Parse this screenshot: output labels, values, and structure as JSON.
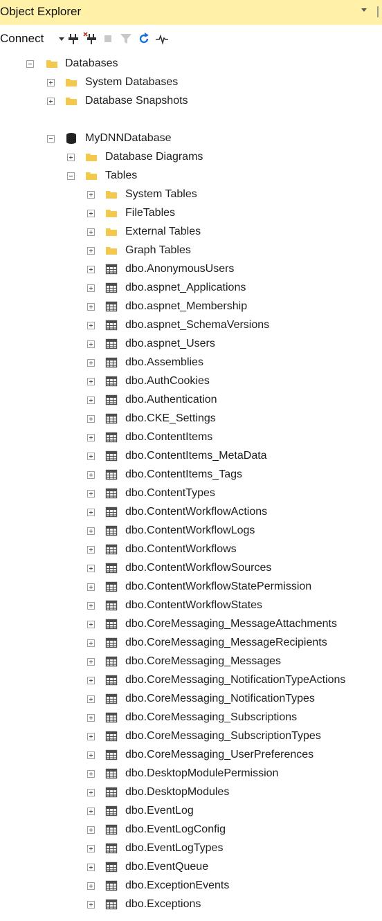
{
  "panel": {
    "title": "Object Explorer"
  },
  "toolbar": {
    "connect_label": "Connect"
  },
  "colors": {
    "title_bar": "#fff1a8",
    "folder": "#f2c94c",
    "table_icon": "#4f4f4f"
  },
  "tree": {
    "databases": "Databases",
    "system_databases": "System Databases",
    "database_snapshots": "Database Snapshots",
    "my_database": "MyDNNDatabase",
    "database_diagrams": "Database Diagrams",
    "tables": "Tables",
    "system_tables": "System Tables",
    "file_tables": "FileTables",
    "external_tables": "External Tables",
    "graph_tables": "Graph Tables",
    "table_items": [
      "dbo.AnonymousUsers",
      "dbo.aspnet_Applications",
      "dbo.aspnet_Membership",
      "dbo.aspnet_SchemaVersions",
      "dbo.aspnet_Users",
      "dbo.Assemblies",
      "dbo.AuthCookies",
      "dbo.Authentication",
      "dbo.CKE_Settings",
      "dbo.ContentItems",
      "dbo.ContentItems_MetaData",
      "dbo.ContentItems_Tags",
      "dbo.ContentTypes",
      "dbo.ContentWorkflowActions",
      "dbo.ContentWorkflowLogs",
      "dbo.ContentWorkflows",
      "dbo.ContentWorkflowSources",
      "dbo.ContentWorkflowStatePermission",
      "dbo.ContentWorkflowStates",
      "dbo.CoreMessaging_MessageAttachments",
      "dbo.CoreMessaging_MessageRecipients",
      "dbo.CoreMessaging_Messages",
      "dbo.CoreMessaging_NotificationTypeActions",
      "dbo.CoreMessaging_NotificationTypes",
      "dbo.CoreMessaging_Subscriptions",
      "dbo.CoreMessaging_SubscriptionTypes",
      "dbo.CoreMessaging_UserPreferences",
      "dbo.DesktopModulePermission",
      "dbo.DesktopModules",
      "dbo.EventLog",
      "dbo.EventLogConfig",
      "dbo.EventLogTypes",
      "dbo.EventQueue",
      "dbo.ExceptionEvents",
      "dbo.Exceptions"
    ]
  }
}
